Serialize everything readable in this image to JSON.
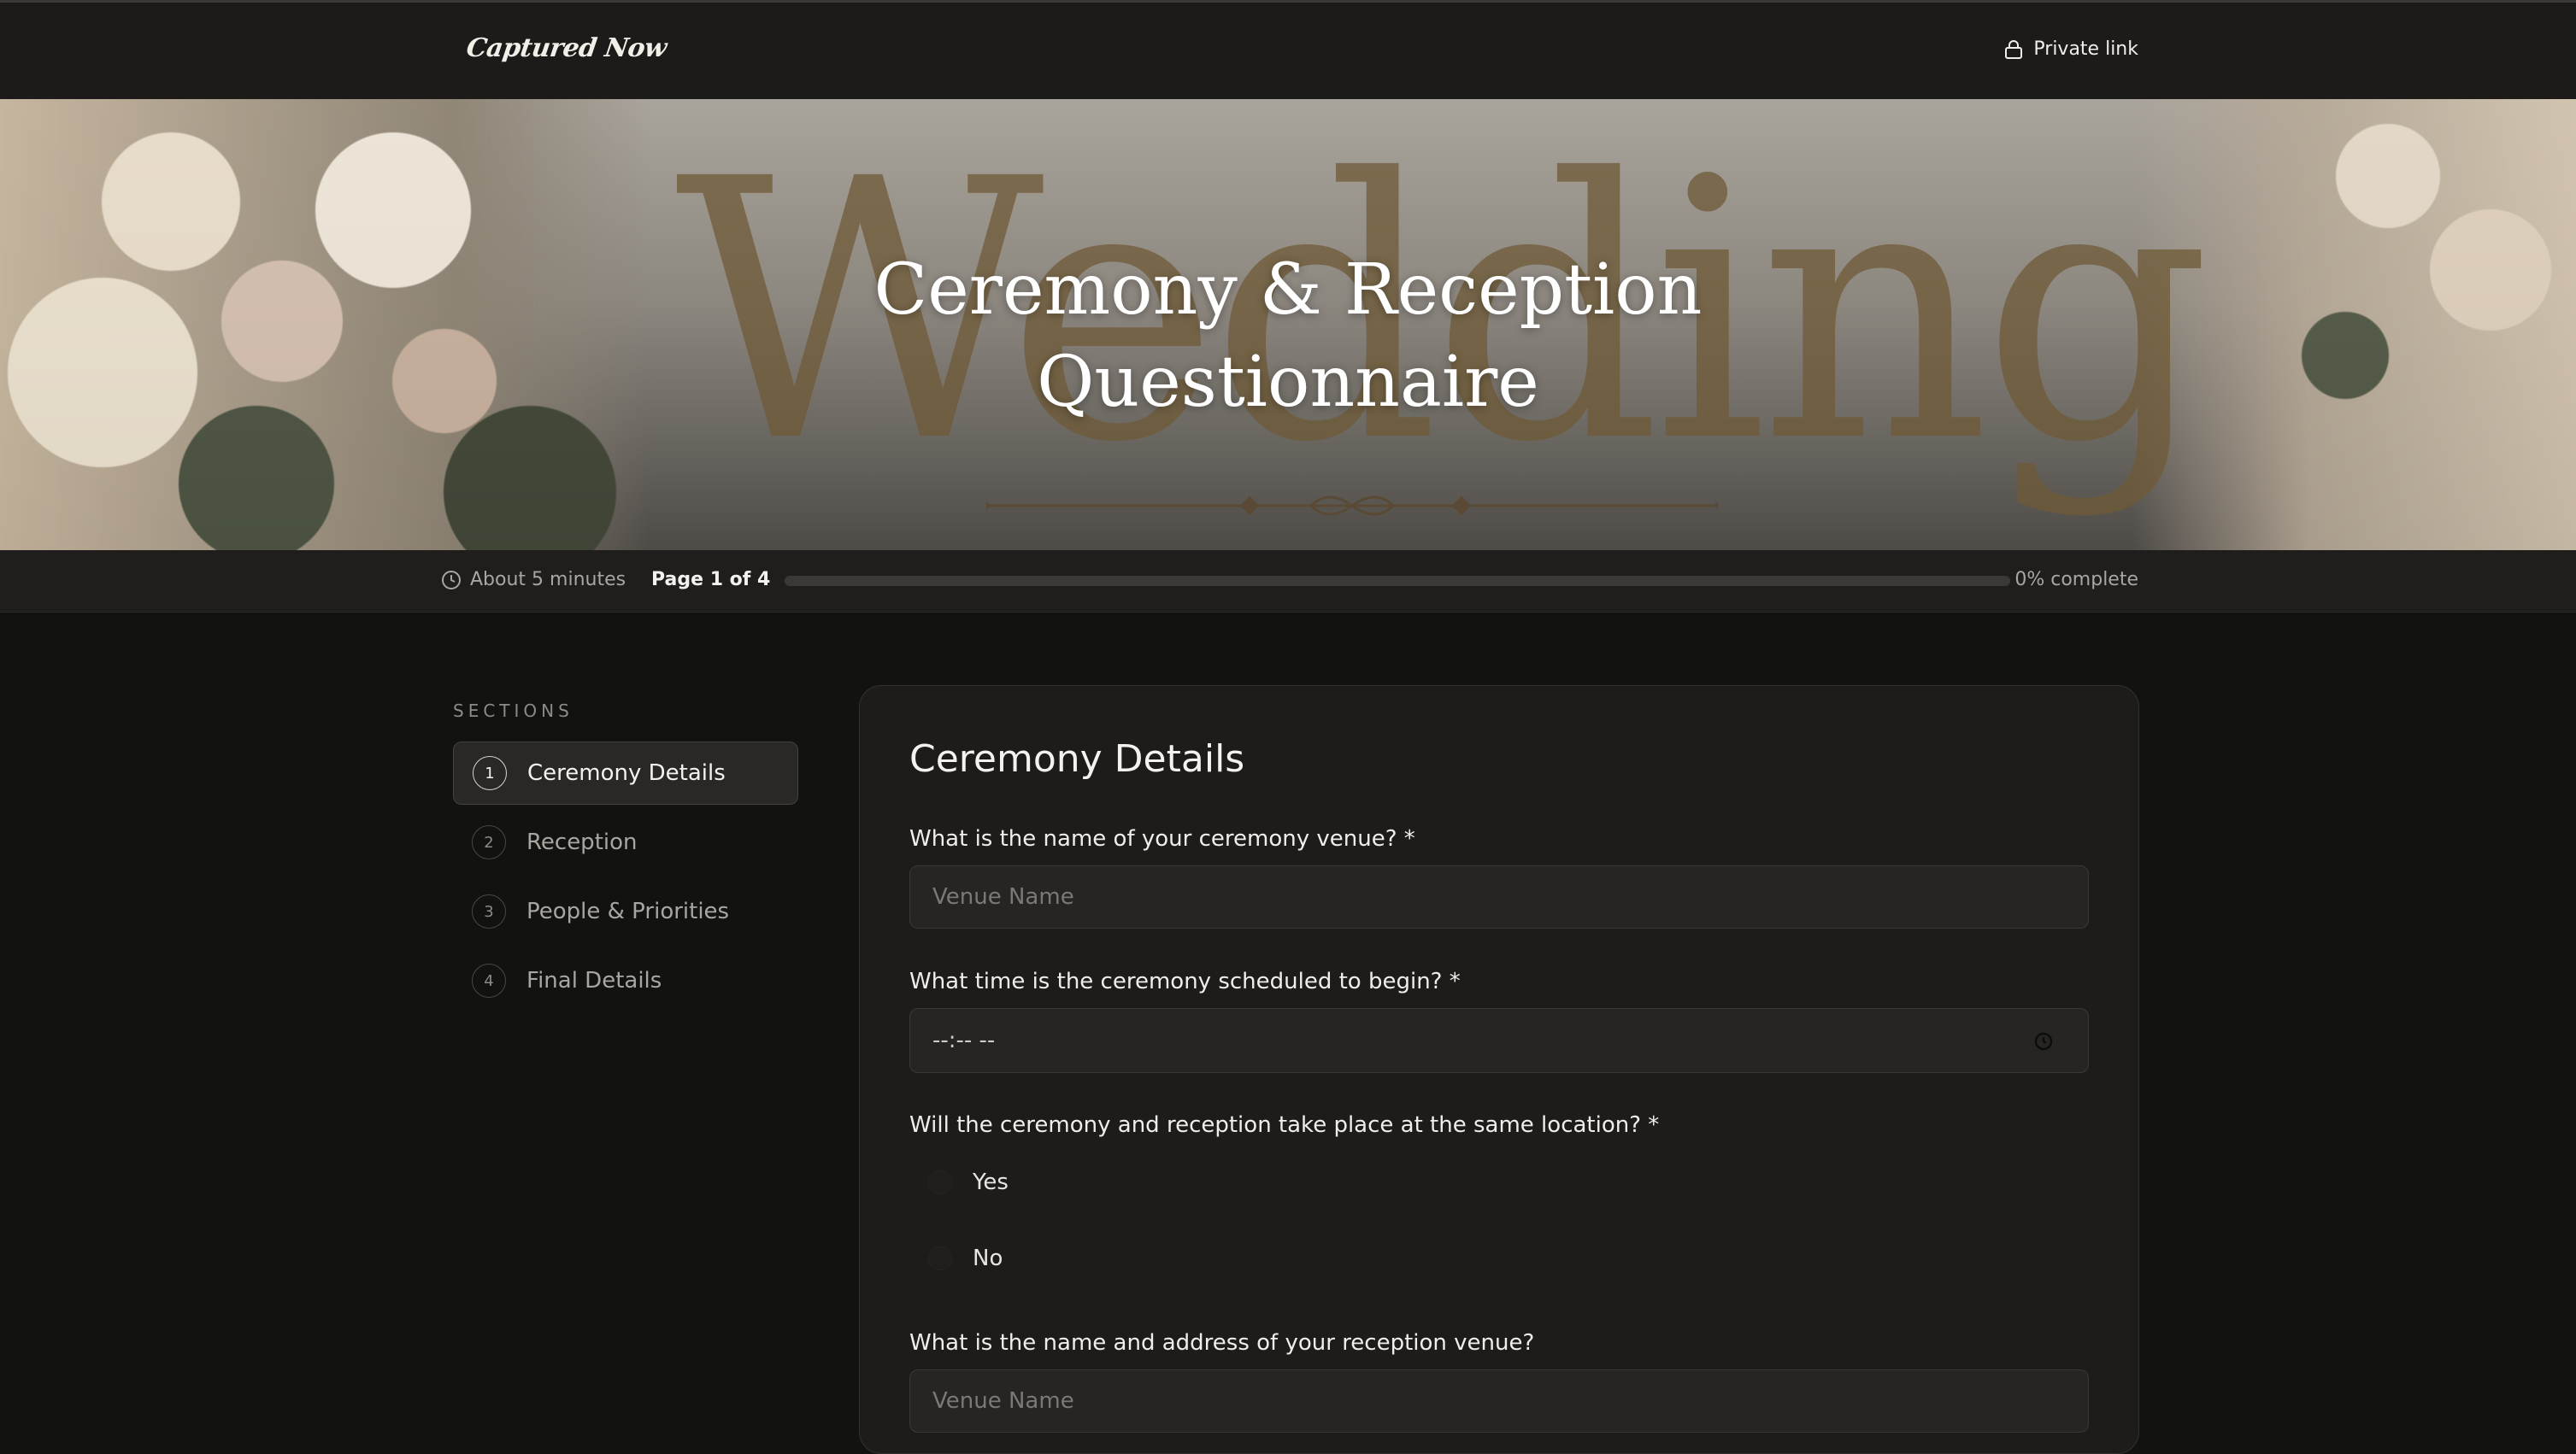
{
  "brand": {
    "logo_text": "Captured Now"
  },
  "header": {
    "private_label": "Private link"
  },
  "hero": {
    "watermark": "Wedding",
    "title_line1": "Ceremony & Reception",
    "title_line2": "Questionnaire"
  },
  "progress": {
    "duration": "About 5 minutes",
    "page": "Page 1 of 4",
    "percent_value": 0,
    "percent_label": "0% complete"
  },
  "sidebar": {
    "heading": "SECTIONS",
    "items": [
      {
        "num": "1",
        "label": "Ceremony Details",
        "active": true
      },
      {
        "num": "2",
        "label": "Reception",
        "active": false
      },
      {
        "num": "3",
        "label": "People & Priorities",
        "active": false
      },
      {
        "num": "4",
        "label": "Final Details",
        "active": false
      }
    ]
  },
  "form": {
    "section_title": "Ceremony Details",
    "q1": {
      "label": "What is the name of your ceremony venue?  *",
      "placeholder": "Venue Name"
    },
    "q2": {
      "label": "What time is the ceremony scheduled to begin? *",
      "value": "--:-- --"
    },
    "q3": {
      "label": "Will the ceremony and reception take place at the same location? *",
      "options": [
        "Yes",
        "No"
      ]
    },
    "q4": {
      "label": "What is the name and address of your reception venue?",
      "placeholder": "Venue Name"
    }
  },
  "colors": {
    "accent": "#bfa57a",
    "background": "#121211",
    "card": "#1d1c1b"
  }
}
